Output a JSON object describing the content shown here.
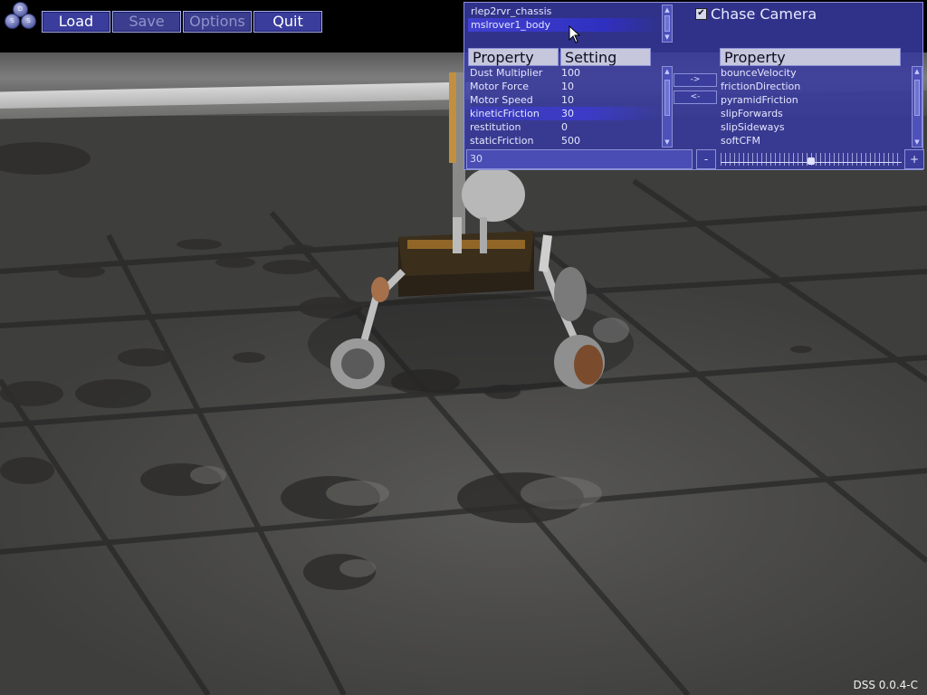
{
  "logo": {
    "letters": [
      "D",
      "S",
      "S"
    ]
  },
  "menu": {
    "load": "Load",
    "save": "Save",
    "options": "Options",
    "quit": "Quit"
  },
  "objects": {
    "items": [
      "rlep2rvr_chassis",
      "mslrover1_body"
    ],
    "selected_index": 1
  },
  "chase_camera": {
    "label": "Chase Camera",
    "checked": true,
    "check_glyph": "✔"
  },
  "properties": {
    "header_property": "Property",
    "header_setting": "Setting",
    "rows": [
      {
        "name": "Dust Multiplier",
        "value": "100"
      },
      {
        "name": "Motor Force",
        "value": "10"
      },
      {
        "name": "Motor Speed",
        "value": "10"
      },
      {
        "name": "kineticFriction",
        "value": "30"
      },
      {
        "name": "restitution",
        "value": "0"
      },
      {
        "name": "staticFriction",
        "value": "500"
      }
    ],
    "selected_index": 3
  },
  "transfer": {
    "add": "->",
    "remove": "<-"
  },
  "available": {
    "header": "Property",
    "items": [
      "bounceVelocity",
      "frictionDirection",
      "pyramidFriction",
      "slipForwards",
      "slipSideways",
      "softCFM"
    ]
  },
  "value_editor": {
    "value": "30",
    "minus": "-",
    "plus": "+",
    "slider_fraction": 0.5
  },
  "version": "DSS 0.0.4-C",
  "colors": {
    "panel": "#383aa0",
    "accent": "#3a3d9c",
    "text": "#e4e6ff"
  },
  "icons": {
    "checkbox": "check-icon",
    "cursor": "mouse-pointer-icon"
  }
}
